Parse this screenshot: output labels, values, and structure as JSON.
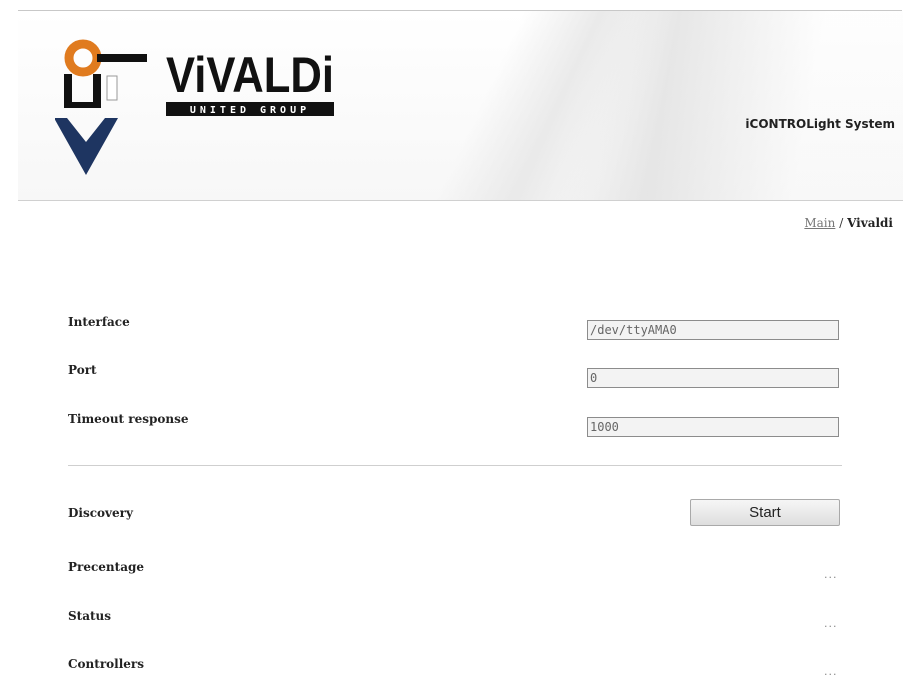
{
  "header": {
    "logo": {
      "brand_name": "ViVALDi",
      "brand_subtitle": "UNITED GROUP"
    },
    "system_title": "iCONTROLight System"
  },
  "breadcrumb": {
    "items": [
      {
        "label": "Main",
        "link": true
      },
      {
        "separator": "/"
      },
      {
        "label": "Vivaldi",
        "link": false
      }
    ]
  },
  "form": {
    "interface": {
      "label": "Interface",
      "value": "/dev/ttyAMA0"
    },
    "port": {
      "label": "Port",
      "value": "0"
    },
    "timeout": {
      "label": "Timeout response",
      "value": "1000"
    }
  },
  "discovery": {
    "label": "Discovery",
    "button_label": "Start"
  },
  "results": {
    "percentage": {
      "label": "Precentage",
      "value": "..."
    },
    "status": {
      "label": "Status",
      "value": "..."
    },
    "controllers": {
      "label": "Controllers",
      "value": "..."
    }
  },
  "colors": {
    "logo_orange": "#e07b1f",
    "logo_navy": "#1e3561",
    "logo_black": "#111111"
  }
}
